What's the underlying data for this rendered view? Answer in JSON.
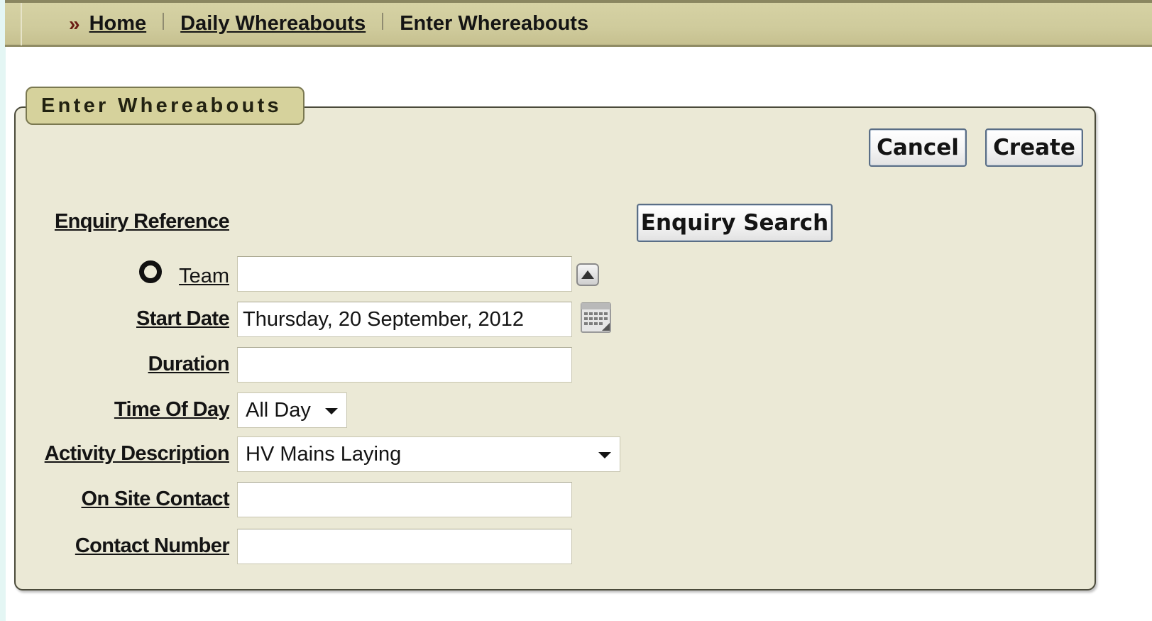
{
  "breadcrumb": {
    "separator_glyph": "»",
    "items": [
      {
        "label": "Home"
      },
      {
        "label": "Daily Whereabouts"
      },
      {
        "label": "Enter Whereabouts"
      }
    ]
  },
  "panel": {
    "title": "Enter Whereabouts",
    "cancel_label": "Cancel",
    "create_label": "Create",
    "enquiry_search_label": "Enquiry Search"
  },
  "form": {
    "enquiry_reference_label": "Enquiry Reference",
    "team": {
      "label": "Team",
      "value": "",
      "icon": "lov-icon"
    },
    "start_date": {
      "label": "Start Date",
      "value": "Thursday, 20 September, 2012",
      "icon": "calendar-icon"
    },
    "duration": {
      "label": "Duration",
      "value": ""
    },
    "time_of_day": {
      "label": "Time Of Day",
      "value": "All Day"
    },
    "activity_description": {
      "label": "Activity Description",
      "value": "HV Mains Laying"
    },
    "on_site_contact": {
      "label": "On Site Contact",
      "value": ""
    },
    "contact_number": {
      "label": "Contact Number",
      "value": ""
    }
  },
  "colors": {
    "breadcrumb_bar": "#cfcb9c",
    "panel_background": "#ebe9d6",
    "title_tab": "#d6d29c",
    "crumb_arrow": "#6b1d14"
  }
}
